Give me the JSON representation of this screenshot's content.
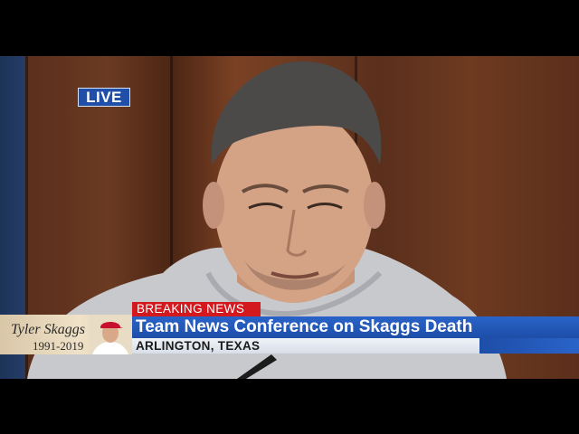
{
  "live_badge": "LIVE",
  "memorial": {
    "name": "Tyler Skaggs",
    "years": "1991-2019"
  },
  "ticker": {
    "breaking": "BREAKING NEWS",
    "headline": "Team News Conference on Skaggs Death",
    "location": "ARLINGTON, TEXAS"
  },
  "colors": {
    "breaking_red": "#d3181e",
    "headline_blue": "#1d4ea8",
    "live_blue": "#1f4fa8"
  }
}
